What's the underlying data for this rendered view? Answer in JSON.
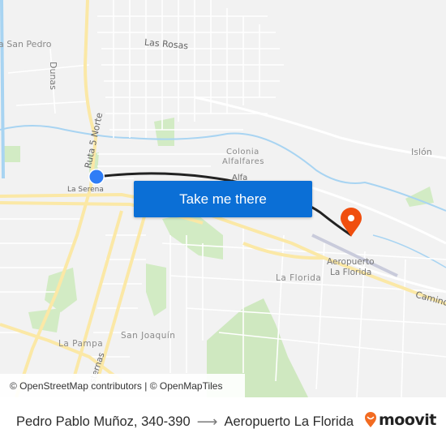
{
  "map": {
    "labels": {
      "san_pedro": "a San Pedro",
      "las_rosas": "Las Rosas",
      "dunas": "Dunas",
      "ruta5": "Ruta 5 Norte",
      "la_serena": "La Serena",
      "colonia": "Colonia",
      "alfalfares": "Alfalfares",
      "alfalfa_cut": "Alfa",
      "islon": "Islón",
      "aeropuerto_1": "Aeropuerto",
      "aeropuerto_2": "La Florida",
      "la_florida": "La Florida",
      "camino": "Camino",
      "san_joaquin": "San Joaquín",
      "la_pampa": "La Pampa",
      "cisternas": "Cisternas"
    },
    "origin_marker": {
      "icon": "origin-dot-icon",
      "color": "#2f7df6"
    },
    "destination_marker": {
      "icon": "map-pin-icon",
      "color": "#f04e0e"
    },
    "route_color": "#222222"
  },
  "cta": {
    "label": "Take me there",
    "color": "#0b6fd6"
  },
  "attribution": {
    "text": "© OpenStreetMap contributors | © OpenMapTiles"
  },
  "footer": {
    "origin": "Pedro Pablo Muñoz, 340-390",
    "arrow": "⟶",
    "destination": "Aeropuerto La Florida",
    "brand": "moovit",
    "brand_color": "#f26b21"
  }
}
